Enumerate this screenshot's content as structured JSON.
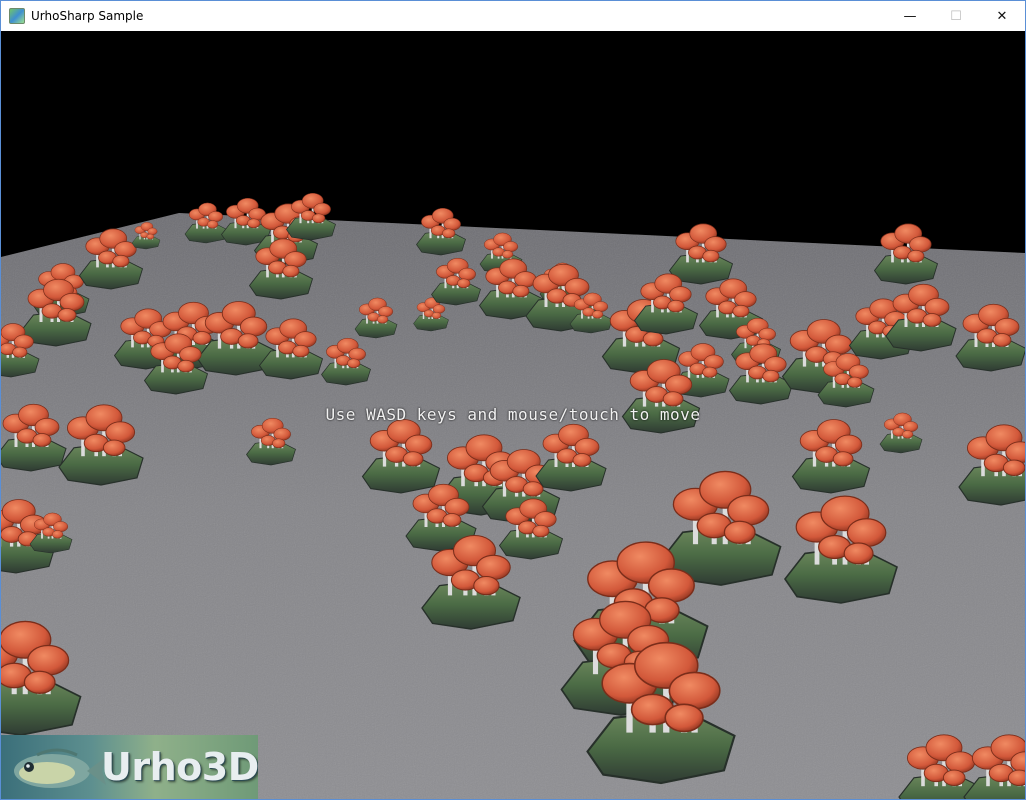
{
  "window": {
    "title": "UrhoSharp Sample",
    "controls": {
      "minimize": "—",
      "maximize": "☐",
      "close": "✕"
    }
  },
  "scene": {
    "hint_text": "Use WASD keys and mouse/touch to move",
    "logo_text": "Urho3D",
    "sky_color": "#000000",
    "ground_color": "#8a8a8e",
    "cap_color": "#d9623e",
    "stem_color": "#dcdcdc",
    "rock_color": "#4f6a4a"
  }
}
